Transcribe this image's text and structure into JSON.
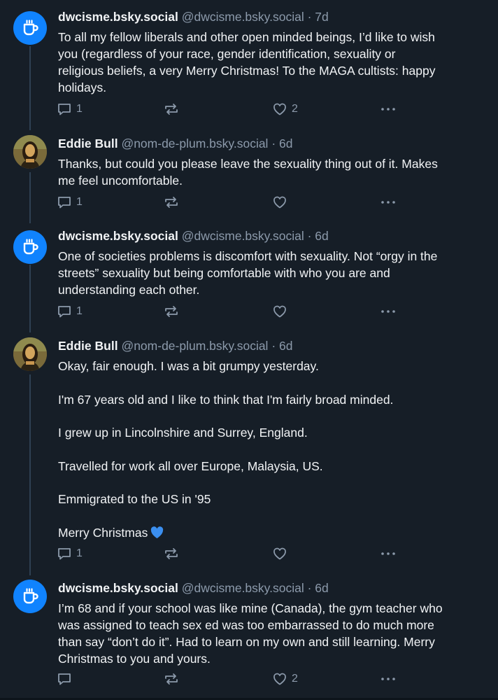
{
  "colors": {
    "background": "#161e27",
    "accent": "#1083fe",
    "muted": "#8c9aab",
    "text": "#f1f3f5"
  },
  "posts": [
    {
      "name": "dwcisme.bsky.social",
      "handle": "@dwcisme.bsky.social",
      "dot": "·",
      "time": "7d",
      "avatar_icon": "coffee-cup-icon",
      "lines": [
        "To all my fellow liberals and other open minded beings, I’d like to wish",
        "you (regardless of your race, gender identification, sexuality or",
        "religious beliefs, a very Merry Christmas! To the MAGA cultists: happy",
        "holidays."
      ],
      "reply_count": "1",
      "like_count": "2"
    },
    {
      "name": "Eddie Bull",
      "handle": "@nom-de-plum.bsky.social",
      "dot": "·",
      "time": "6d",
      "avatar_icon": "mona-lisa-avatar",
      "lines": [
        "Thanks, but could you please leave the sexuality thing out of it. Makes",
        "me feel uncomfortable."
      ],
      "reply_count": "1",
      "like_count": ""
    },
    {
      "name": "dwcisme.bsky.social",
      "handle": "@dwcisme.bsky.social",
      "dot": "·",
      "time": "6d",
      "avatar_icon": "coffee-cup-icon",
      "lines": [
        "One of societies problems is discomfort with sexuality. Not “orgy in the",
        "streets” sexuality but being comfortable with who you are and",
        "understanding each other."
      ],
      "reply_count": "1",
      "like_count": ""
    },
    {
      "name": "Eddie Bull",
      "handle": "@nom-de-plum.bsky.social",
      "dot": "·",
      "time": "6d",
      "avatar_icon": "mona-lisa-avatar",
      "paragraphs": [
        "Okay, fair enough. I was a bit grumpy yesterday.",
        "I'm 67 years old and I like to think that I'm fairly broad minded.",
        "I grew up in Lincolnshire and Surrey, England.",
        "Travelled for work all over Europe, Malaysia, US.",
        "Emmigrated to the US in '95",
        "Merry Christmas"
      ],
      "emoji": "blue-heart-icon",
      "reply_count": "1",
      "like_count": ""
    },
    {
      "name": "dwcisme.bsky.social",
      "handle": "@dwcisme.bsky.social",
      "dot": "·",
      "time": "6d",
      "avatar_icon": "coffee-cup-icon",
      "lines": [
        "I’m 68 and if your school was like mine (Canada), the gym teacher who",
        "was assigned to teach sex ed was too embarrassed to do much more",
        "than say “don’t do it”. Had to learn on my own and still learning. Merry",
        "Christmas to you and yours."
      ],
      "reply_count": "",
      "like_count": "2"
    }
  ]
}
